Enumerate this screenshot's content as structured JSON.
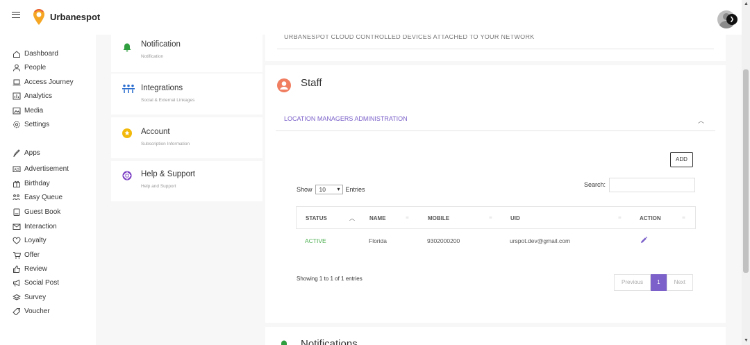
{
  "app": {
    "brand": "Urbanespot"
  },
  "sidebar": {
    "items": [
      {
        "label": "Dashboard",
        "icon": "home-icon"
      },
      {
        "label": "People",
        "icon": "person-icon"
      },
      {
        "label": "Access Journey",
        "icon": "laptop-icon"
      },
      {
        "label": "Analytics",
        "icon": "bar-chart-icon"
      },
      {
        "label": "Media",
        "icon": "image-icon"
      },
      {
        "label": "Settings",
        "icon": "gear-icon"
      },
      {
        "label": "Apps",
        "icon": "rocket-icon"
      },
      {
        "label": "Advertisement",
        "icon": "ad-icon"
      },
      {
        "label": "Birthday",
        "icon": "gift-icon"
      },
      {
        "label": "Easy Queue",
        "icon": "queue-icon"
      },
      {
        "label": "Guest Book",
        "icon": "book-icon"
      },
      {
        "label": "Interaction",
        "icon": "message-icon"
      },
      {
        "label": "Loyalty",
        "icon": "heart-icon"
      },
      {
        "label": "Offer",
        "icon": "cart-icon"
      },
      {
        "label": "Review",
        "icon": "thumbs-up-icon"
      },
      {
        "label": "Social Post",
        "icon": "megaphone-icon"
      },
      {
        "label": "Survey",
        "icon": "layers-icon"
      },
      {
        "label": "Voucher",
        "icon": "tag-icon"
      }
    ]
  },
  "settings_cards": [
    {
      "title": "Notification",
      "subtitle": "Notification",
      "icon": "bell-icon",
      "color": "#2e9e3e"
    },
    {
      "title": "Integrations",
      "subtitle": "Social & External Linkages",
      "icon": "integrations-icon",
      "color": "#2d6fcf"
    },
    {
      "title": "Account",
      "subtitle": "Subscription Information",
      "icon": "star-icon",
      "color": "#f2b90c"
    },
    {
      "title": "Help & Support",
      "subtitle": "Help and Support",
      "icon": "lifebuoy-icon",
      "color": "#7b3fc4"
    }
  ],
  "main": {
    "top_section_text": "URBANESPOT CLOUD CONTROLLED DEVICES ATTACHED TO YOUR NETWORK",
    "staff": {
      "title": "Staff",
      "accordion_title": "LOCATION MANAGERS ADMINISTRATION",
      "add_label": "ADD",
      "show_label": "Show",
      "entries_value": "10",
      "entries_label": "Entries",
      "search_label": "Search:",
      "search_value": "",
      "columns": [
        "STATUS",
        "NAME",
        "MOBILE",
        "UID",
        "ACTION"
      ],
      "rows": [
        {
          "status": "ACTIVE",
          "name": "Florida",
          "mobile": "9302000200",
          "uid": "urspot.dev@gmail.com"
        }
      ],
      "showing_text": "Showing 1 to 1 of 1 entries",
      "pager": {
        "previous": "Previous",
        "current": "1",
        "next": "Next"
      }
    },
    "notifications_title": "Notifications"
  },
  "colors": {
    "accent": "#7b61c9",
    "active": "#4caf50",
    "staff_icon": "#f07e61"
  }
}
